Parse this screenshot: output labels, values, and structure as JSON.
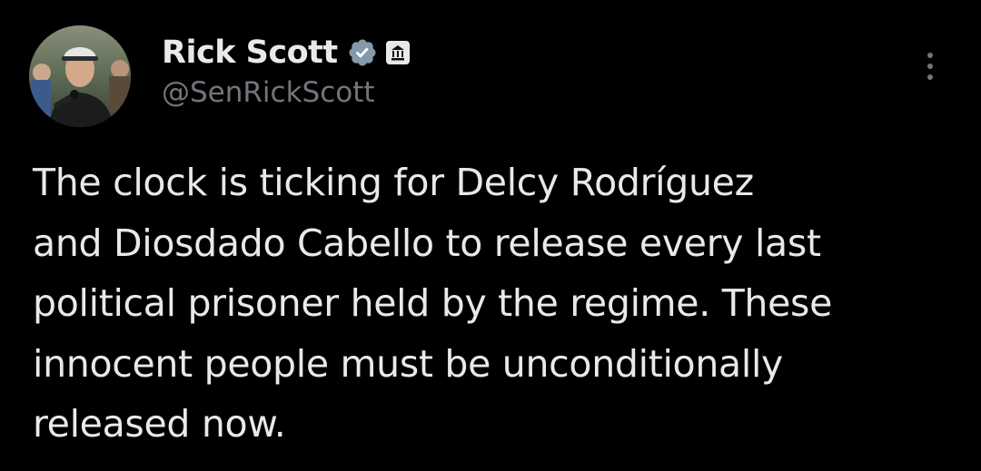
{
  "author": {
    "display_name": "Rick Scott",
    "handle": "@SenRickScott",
    "verified_badge_color": "#829aab",
    "badges": [
      "verified-badge-icon",
      "government-building-icon"
    ]
  },
  "menu": {
    "more_icon": "more-options-icon"
  },
  "tweet": {
    "lines": [
      "The clock is ticking for Delcy Rodríguez",
      "and Diosdado Cabello to release every last",
      "political prisoner held by the regime. These",
      "innocent people must be unconditionally",
      "released now."
    ]
  },
  "colors": {
    "background": "#000000",
    "primary_text": "#e7e9ea",
    "secondary_text": "#71767b"
  }
}
